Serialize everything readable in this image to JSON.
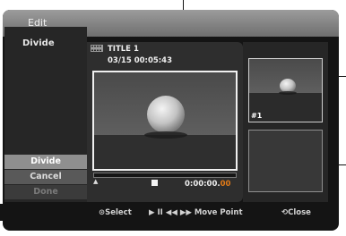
{
  "window": {
    "title": "Edit"
  },
  "sidebar": {
    "heading": "Divide"
  },
  "menu": {
    "divide_label": "Divide",
    "cancel_label": "Cancel",
    "done_label": "Done"
  },
  "main": {
    "title": "TITLE 1",
    "datetime": "03/15   00:05:43",
    "timeline_marker": "▲",
    "timecode_prefix": "0:00:00.",
    "timecode_frames": "00"
  },
  "right": {
    "thumb1_label": "#1"
  },
  "footer": {
    "select": "⊙Select",
    "move_point": "▶ II ◀◀ ▶▶  Move Point",
    "close": "⟲Close"
  },
  "colors": {
    "accent_orange": "#e07a18",
    "panel": "#2e2e2e"
  }
}
